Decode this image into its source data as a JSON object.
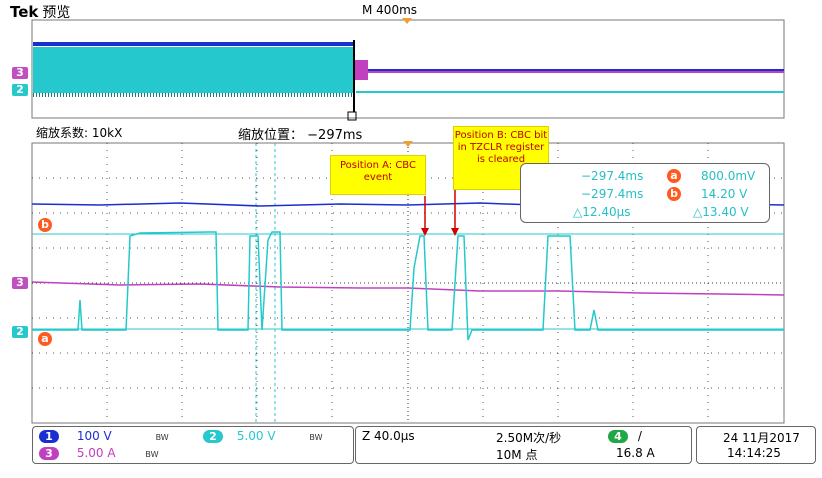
{
  "header": {
    "brand": "Tek",
    "mode": "预览",
    "timebase": "M 400ms"
  },
  "zoom": {
    "factor": "缩放系数: 10kX",
    "position_label": "缩放位置：",
    "position_value": "−297ms",
    "cursor_icon": "bracket-icon"
  },
  "channel_markers": {
    "ch3": "3",
    "ch2": "2",
    "cursor_b": "b",
    "cursor_a": "a"
  },
  "annotations": {
    "position_a": "Position A: CBC event",
    "position_b": "Position B: CBC bit in TZCLR register is cleared"
  },
  "cursor_readout": {
    "a_time": "−297.4ms",
    "a_value": "800.0mV",
    "b_time": "−297.4ms",
    "b_value": "14.20 V",
    "delta_time": "△12.40µs",
    "delta_value": "△13.40 V",
    "a_label": "a",
    "b_label": "b"
  },
  "status": {
    "ch1_num": "1",
    "ch1_scale": "100 V",
    "ch1_bw": "BW",
    "ch2_num": "2",
    "ch2_scale": "5.00 V",
    "ch2_bw": "BW",
    "ch3_num": "3",
    "ch3_scale": "5.00 A",
    "ch3_bw": "BW",
    "zoom_time": "Z 40.0µs",
    "sample_rate": "2.50M次/秒",
    "record_length": "10M 点",
    "trigger_source": "4",
    "trigger_slope": "/",
    "trigger_level": "16.8 A",
    "date": "24 11月2017",
    "time": "14:14:25"
  },
  "colors": {
    "ch1": "#1a2fd0",
    "ch2": "#25c8cc",
    "ch3": "#c040c0",
    "ch4": "#1fa845",
    "cursor": "#ff5a1f",
    "trigger": "#f0a030"
  }
}
